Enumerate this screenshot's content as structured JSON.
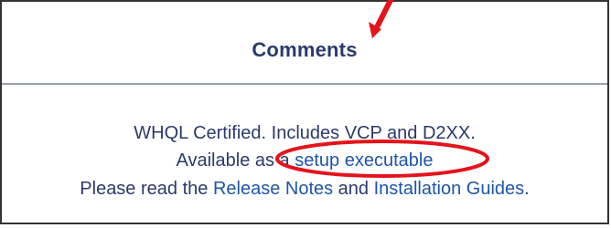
{
  "comments": {
    "header": "Comments",
    "line1": "WHQL Certified. Includes VCP and D2XX.",
    "line2_prefix": "Available as a ",
    "line2_link": "setup executable",
    "line3_prefix": "Please read the ",
    "line3_link_release_notes": "Release Notes",
    "line3_joiner": " and ",
    "line3_link_installation_guides": "Installation Guides",
    "line3_suffix": "."
  },
  "colors": {
    "annotation": "#e3141c",
    "text": "#2b3a6b",
    "link": "#1f55a8"
  }
}
